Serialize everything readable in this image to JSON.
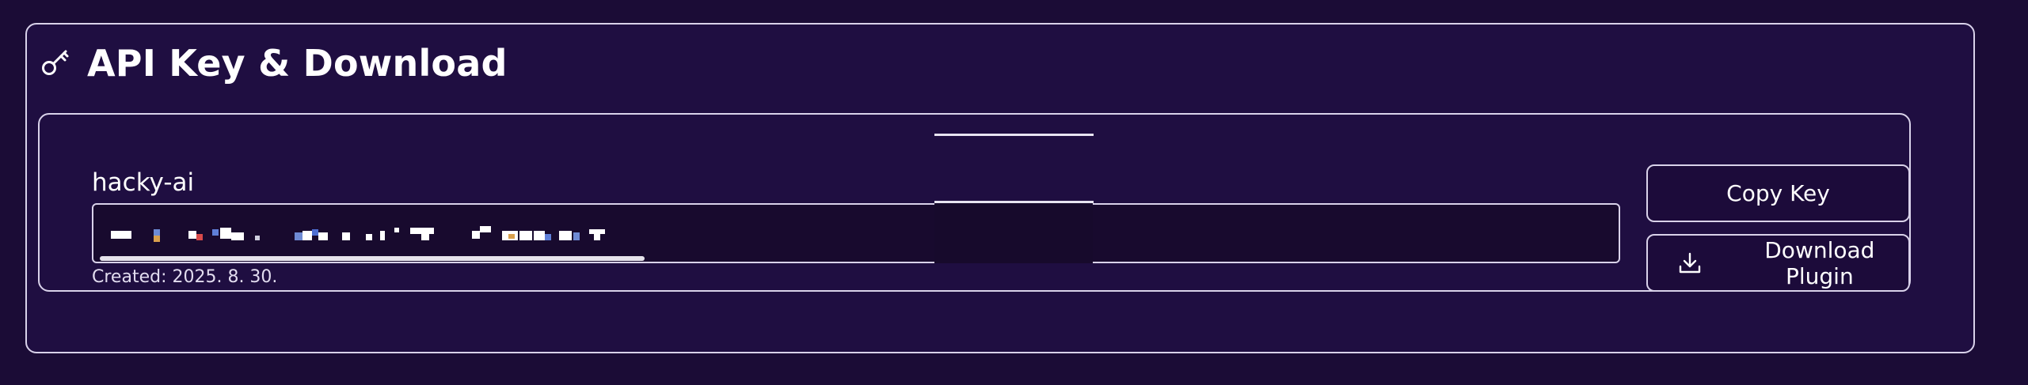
{
  "section": {
    "title": "API Key & Download",
    "icon": "key-icon"
  },
  "key": {
    "name": "hacky-ai",
    "masked_value": "",
    "created": "Created: 2025. 8. 30.",
    "scroll_fraction": 0.36
  },
  "buttons": {
    "copy_label": "Copy Key",
    "download_label": "Download Plugin",
    "download_icon": "download-icon"
  },
  "colors": {
    "background": "#1b0c36",
    "panel": "#1f0e41",
    "border": "#d9d2ea",
    "text": "#ffffff"
  }
}
